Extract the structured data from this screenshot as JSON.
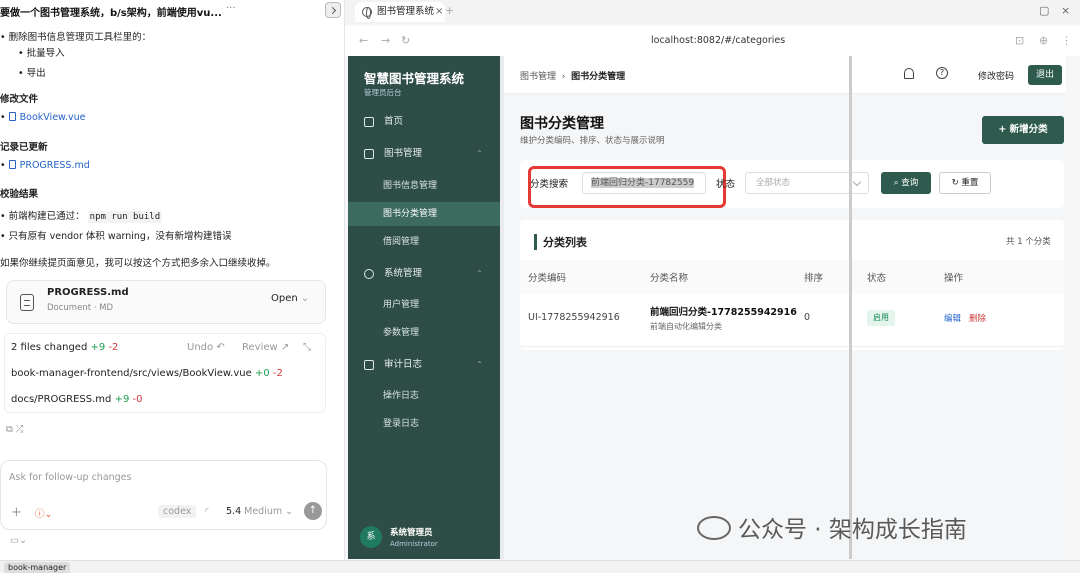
{
  "chat": {
    "title": "要做一个图书管理系统，b/s架构，前端使用vu...",
    "menu_dots": "···",
    "intro": "删除图书信息管理页工具栏里的：",
    "removed": [
      "批量导入",
      "导出"
    ],
    "modified_heading": "修改文件",
    "modified_file": "BookView.vue",
    "recorded_heading": "记录已更新",
    "recorded_file": "PROGRESS.md",
    "verify_heading": "校验结果",
    "verify_line1_prefix": "前端构建已通过：",
    "verify_line1_code": "npm run build",
    "verify_line2": "只有原有 vendor 体积 warning，没有新增构建错误",
    "followup_note": "如果你继续提页面意见，我可以按这个方式把多余入口继续收掉。",
    "card": {
      "title": "PROGRESS.md",
      "subtitle": "Document · MD",
      "open": "Open"
    },
    "changes": {
      "summary": "2 files changed",
      "summary_plus": "+9",
      "summary_minus": "-2",
      "undo": "Undo",
      "review": "Review",
      "files": [
        {
          "path": "book-manager-frontend/src/views/BookView.vue",
          "plus": "+0",
          "minus": "-2"
        },
        {
          "path": "docs/PROGRESS.md",
          "plus": "+9",
          "minus": "-0"
        }
      ]
    },
    "input_placeholder": "Ask for follow-up changes",
    "model_tag": "codex",
    "model": "5.4",
    "effort": "Medium",
    "bottom_tag": "book-manager"
  },
  "browser": {
    "tab_title": "图书管理系统",
    "url": "localhost:8082/#/categories"
  },
  "app": {
    "logo": "智慧图书管理系统",
    "logo_sub": "管理员后台",
    "nav": {
      "home": "首页",
      "books": "图书管理",
      "book_info": "图书信息管理",
      "book_category": "图书分类管理",
      "borrow": "借阅管理",
      "system": "系统管理",
      "users": "用户管理",
      "params": "参数管理",
      "audit": "审计日志",
      "op_log": "操作日志",
      "login_log": "登录日志"
    },
    "user": {
      "avatar": "系",
      "name": "系统管理员",
      "role": "Administrator"
    },
    "breadcrumb": {
      "parent": "图书管理",
      "current": "图书分类管理"
    },
    "change_password": "修改密码",
    "logout": "退出",
    "page_title": "图书分类管理",
    "page_subtitle": "维护分类编码、排序、状态与展示说明",
    "add_button": "+ 新增分类",
    "filter": {
      "search_label": "分类搜索",
      "search_value": "前端回归分类-17782559",
      "status_label": "状态",
      "status_placeholder": "全部状态",
      "query": "查询",
      "reset": "重置"
    },
    "table": {
      "title": "分类列表",
      "count": "共 1 个分类",
      "headers": [
        "分类编码",
        "分类名称",
        "排序",
        "状态",
        "操作"
      ],
      "rows": [
        {
          "code": "UI-1778255942916",
          "name": "前端回归分类-1778255942916",
          "desc": "前端自动化编辑分类",
          "sort": "0",
          "status": "启用",
          "edit": "编辑",
          "delete": "删除"
        }
      ]
    },
    "watermark": "公众号 · 架构成长指南"
  }
}
